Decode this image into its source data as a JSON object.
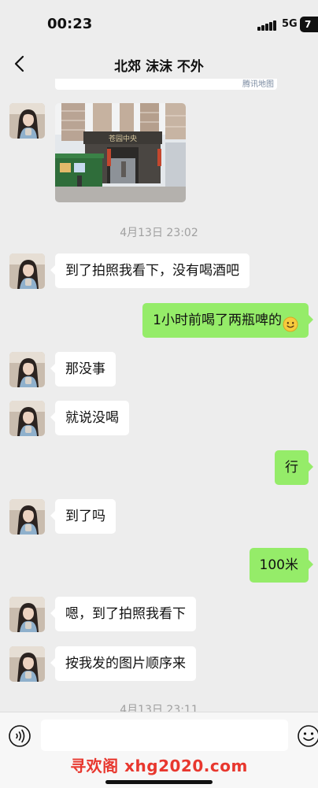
{
  "status_bar": {
    "time": "00:23",
    "network": "5G",
    "battery": "7"
  },
  "header": {
    "title": "北郊 沫沫 不外"
  },
  "map_card": {
    "label": "腾讯地图"
  },
  "photo": {
    "sign_text": "苍园中央"
  },
  "timestamps": {
    "first": "4月13日 23:02",
    "second": "4月13日 23:11"
  },
  "messages": [
    {
      "direction": "in",
      "text": "到了拍照我看下，没有喝酒吧"
    },
    {
      "direction": "out",
      "text": "1小时前喝了两瓶啤的"
    },
    {
      "direction": "in",
      "text": "那没事"
    },
    {
      "direction": "in",
      "text": "就说没喝"
    },
    {
      "direction": "out",
      "text": "行"
    },
    {
      "direction": "in",
      "text": "到了吗"
    },
    {
      "direction": "out",
      "text": "100米"
    },
    {
      "direction": "in",
      "text": "嗯，到了拍照我看下"
    },
    {
      "direction": "in",
      "text": "按我发的图片顺序来"
    }
  ],
  "input": {
    "value": "",
    "placeholder": ""
  },
  "watermark": "寻欢阁 xhg2020.com",
  "colors": {
    "background": "#ededed",
    "incoming_bubble": "#ffffff",
    "outgoing_bubble": "#95ec69",
    "watermark": "#e8372e"
  },
  "icons": {
    "back": "chevron-left-icon",
    "voice": "voice-icon",
    "emoji": "smiley-icon",
    "message_emoji": "smile-emoji"
  }
}
